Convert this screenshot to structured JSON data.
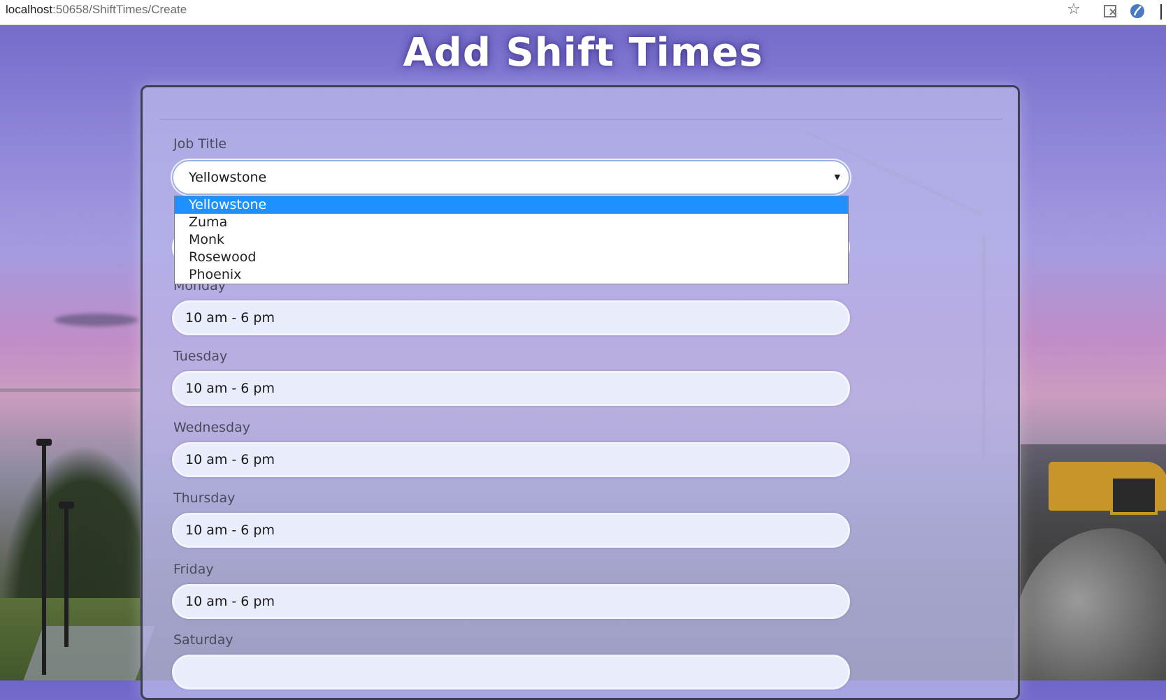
{
  "browser": {
    "url_host": "localhost",
    "url_rest": ":50658/ShiftTimes/Create",
    "icons": [
      "star-icon",
      "extension-icon",
      "profile-icon"
    ]
  },
  "page": {
    "title": "Add Shift Times"
  },
  "form": {
    "job_title": {
      "label": "Job Title",
      "selected": "Yellowstone",
      "options": [
        "Yellowstone",
        "Zuma",
        "Monk",
        "Rosewood",
        "Phoenix"
      ]
    },
    "days": [
      {
        "label": "Monday",
        "value": "10 am - 6 pm"
      },
      {
        "label": "Tuesday",
        "value": "10 am - 6 pm"
      },
      {
        "label": "Wednesday",
        "value": "10 am - 6 pm"
      },
      {
        "label": "Thursday",
        "value": "10 am - 6 pm"
      },
      {
        "label": "Friday",
        "value": "10 am - 6 pm"
      },
      {
        "label": "Saturday",
        "value": ""
      }
    ]
  },
  "colors": {
    "highlight": "#1e90ff",
    "panel": "#b6b4e8",
    "title_text": "#ffffff"
  }
}
